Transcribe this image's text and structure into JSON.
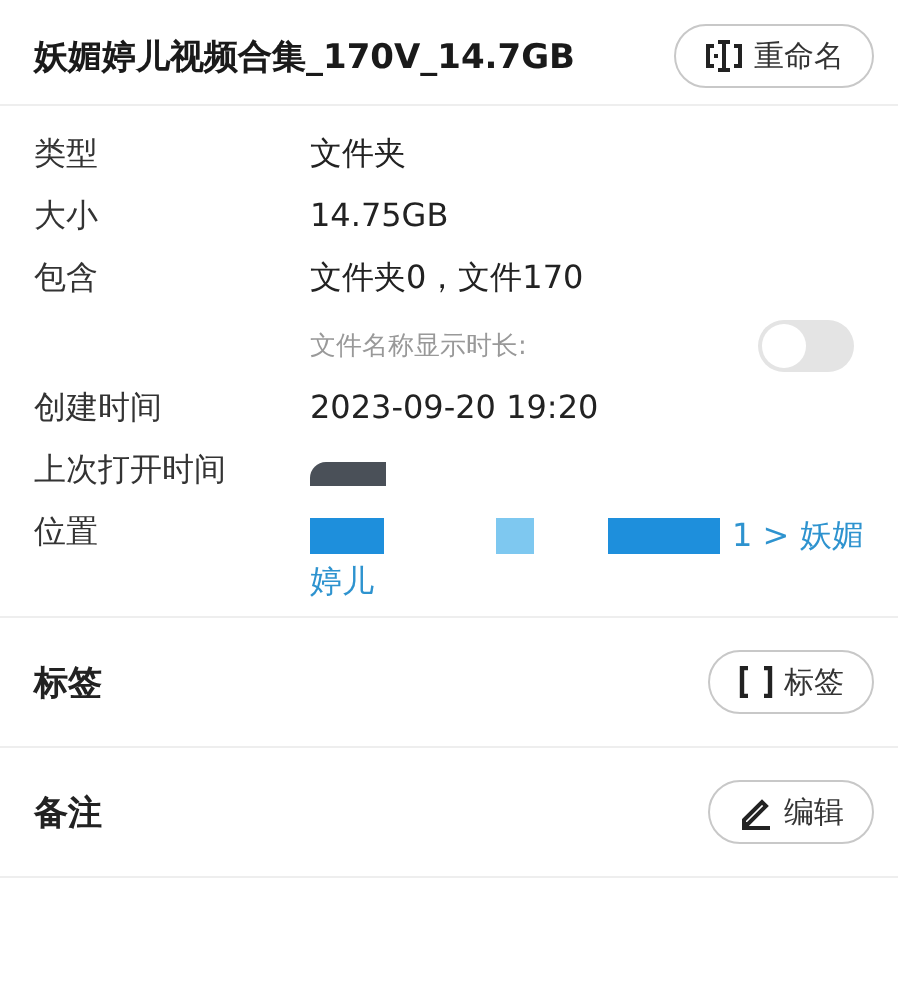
{
  "header": {
    "title": "妖媚婷儿视频合集_170V_14.7GB",
    "button": "重命名"
  },
  "properties": [
    {
      "kind": "text",
      "label": "类型",
      "value": "文件夹"
    },
    {
      "kind": "text",
      "label": "大小",
      "value": "14.75GB"
    },
    {
      "kind": "text",
      "label": "包含",
      "value": "文件夹0，文件170"
    },
    {
      "kind": "toggle",
      "label": "文件名称显示时长:",
      "on": false
    },
    {
      "kind": "text",
      "label": "创建时间",
      "value": "2023-09-20 19:20"
    },
    {
      "kind": "redacted",
      "label": "上次打开时间"
    },
    {
      "kind": "link",
      "label": "位置",
      "lines": [
        "1 > 妖媚",
        "婷儿"
      ],
      "redacted": true
    }
  ],
  "sections": [
    {
      "kind": "tags",
      "label": "标签",
      "button": "标签"
    },
    {
      "kind": "notes",
      "label": "备注",
      "button": "编辑"
    }
  ]
}
